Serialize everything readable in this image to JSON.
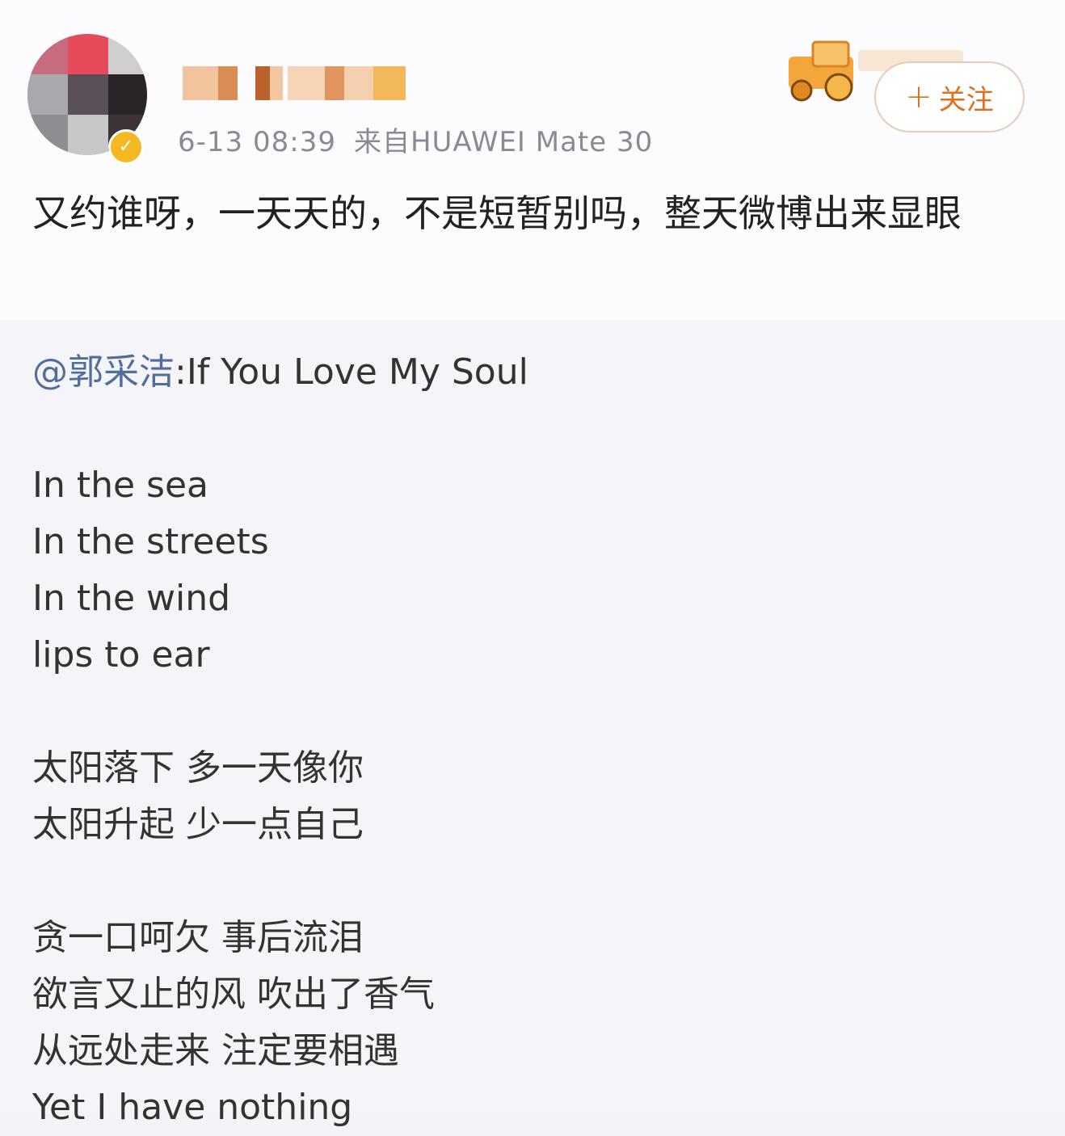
{
  "header": {
    "timestamp": "6-13 08:39",
    "source": "来自HUAWEI Mate 30",
    "follow_label": "关注",
    "follow_plus": "+",
    "verified_icon": "verified-badge-icon"
  },
  "post": {
    "text": "又约谁呀，一天天的，不是短暂别吗，整天微博出来显眼"
  },
  "repost": {
    "mention": "@郭采洁",
    "title": ":If You Love My Soul",
    "stanzas": [
      [
        "In the sea",
        "In the streets",
        "In the wind",
        "lips to ear"
      ],
      [
        "太阳落下  多一天像你",
        "太阳升起  少一点自己"
      ],
      [
        "贪一口呵欠 事后流泪",
        "欲言又止的风 吹出了香气",
        "从远处走来 注定要相遇",
        "Yet I have nothing"
      ]
    ]
  },
  "colors": {
    "accent": "#e06f1f",
    "mention": "#4f6e9a",
    "badge": "#f4b821"
  }
}
